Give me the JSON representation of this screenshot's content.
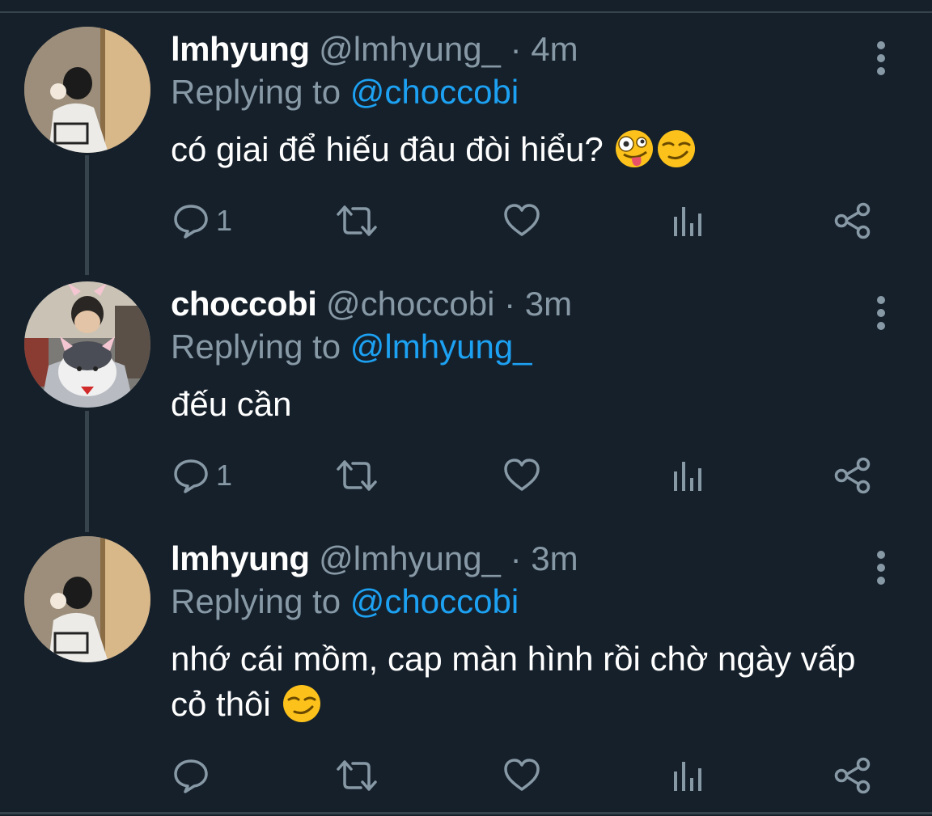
{
  "tweets": [
    {
      "display_name": "lmhyung",
      "handle": "@lmhyung_",
      "time": "4m",
      "replying_prefix": "Replying to",
      "replying_to": "@choccobi",
      "text": "có giai để hiếu đâu đòi hiểu?",
      "emojis": [
        "zany-face",
        "smirk-face"
      ],
      "reply_count": "1",
      "avatar": "lmhyung-avatar"
    },
    {
      "display_name": "choccobi",
      "handle": "@choccobi",
      "time": "3m",
      "replying_prefix": "Replying to",
      "replying_to": "@lmhyung_",
      "text": "đếu cần",
      "emojis": [],
      "reply_count": "1",
      "avatar": "choccobi-avatar"
    },
    {
      "display_name": "lmhyung",
      "handle": "@lmhyung_",
      "time": "3m",
      "replying_prefix": "Replying to",
      "replying_to": "@choccobi",
      "text": "nhớ cái mồm, cap màn hình rồi chờ ngày vấp cỏ thôi",
      "emojis": [
        "smirk-face"
      ],
      "reply_count": "",
      "avatar": "lmhyung-avatar"
    }
  ],
  "separator": "·",
  "icons": [
    "reply-icon",
    "retweet-icon",
    "like-icon",
    "analytics-icon",
    "share-icon",
    "more-icon"
  ],
  "colors": {
    "background": "#15202b",
    "secondary_text": "#8899a6",
    "link": "#1da1f2",
    "divider": "#38444d"
  }
}
